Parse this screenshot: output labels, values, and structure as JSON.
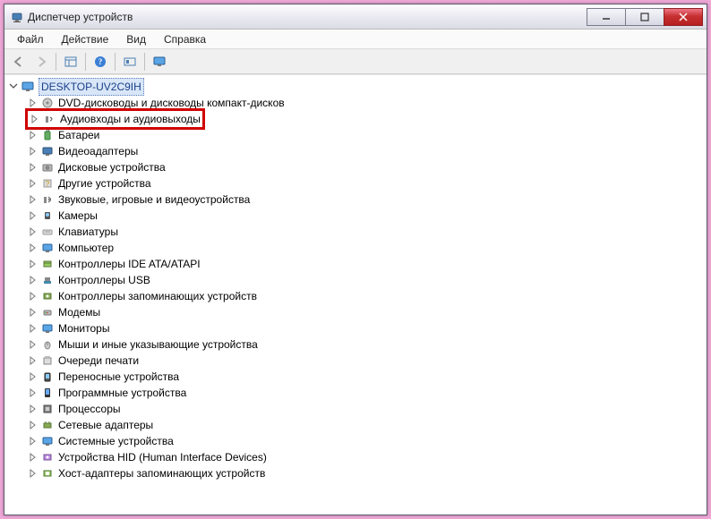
{
  "window": {
    "title": "Диспетчер устройств"
  },
  "menu": {
    "file": "Файл",
    "action": "Действие",
    "view": "Вид",
    "help": "Справка"
  },
  "tree": {
    "root": "DESKTOP-UV2C9IH",
    "items": [
      "DVD-дисководы и дисководы компакт-дисков",
      "Аудиовходы и аудиовыходы",
      "Батареи",
      "Видеоадаптеры",
      "Дисковые устройства",
      "Другие устройства",
      "Звуковые, игровые и видеоустройства",
      "Камеры",
      "Клавиатуры",
      "Компьютер",
      "Контроллеры IDE ATA/ATAPI",
      "Контроллеры USB",
      "Контроллеры запоминающих устройств",
      "Модемы",
      "Мониторы",
      "Мыши и иные указывающие устройства",
      "Очереди печати",
      "Переносные устройства",
      "Программные устройства",
      "Процессоры",
      "Сетевые адаптеры",
      "Системные устройства",
      "Устройства HID (Human Interface Devices)",
      "Хост-адаптеры запоминающих устройств"
    ]
  },
  "highlighted_index": 1
}
